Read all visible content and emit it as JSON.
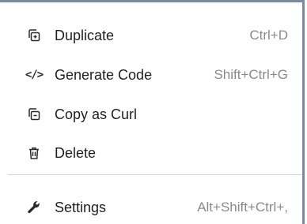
{
  "menu": {
    "items": [
      {
        "label": "Duplicate",
        "shortcut": "Ctrl+D",
        "icon": "duplicate-icon"
      },
      {
        "label": "Generate Code",
        "shortcut": "Shift+Ctrl+G",
        "icon": "code-icon",
        "glyph": "</>"
      },
      {
        "label": "Copy as Curl",
        "shortcut": "",
        "icon": "copy-icon"
      },
      {
        "label": "Delete",
        "shortcut": "",
        "icon": "trash-icon"
      }
    ],
    "settings": {
      "label": "Settings",
      "shortcut": "Alt+Shift+Ctrl+,",
      "icon": "wrench-icon"
    }
  },
  "colors": {
    "border": "#7b8b9c",
    "text": "#1f1f1f",
    "shortcut": "#8a8a8a",
    "separator": "#d6d6d6"
  }
}
